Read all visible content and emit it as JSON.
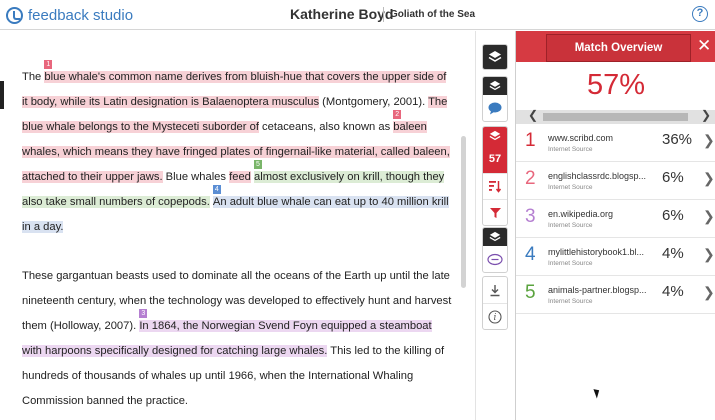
{
  "app": {
    "logo_text": "feedback studio",
    "student_name": "Katherine Boyd",
    "doc_title": "Goliath of the Sea",
    "help_symbol": "?"
  },
  "toolbar": {
    "match_count": "57"
  },
  "panel": {
    "title": "Match Overview",
    "close_symbol": "✕",
    "score": "57%",
    "nav_left": "❮",
    "nav_right": "❯",
    "matches": [
      {
        "num": "1",
        "source": "www.scribd.com",
        "type": "Internet Source",
        "pct": "36%",
        "color": "#d42a36"
      },
      {
        "num": "2",
        "source": "englishclassrdc.blogsp...",
        "type": "Internet Source",
        "pct": "6%",
        "color": "#e8677d"
      },
      {
        "num": "3",
        "source": "en.wikipedia.org",
        "type": "Internet Source",
        "pct": "6%",
        "color": "#b57fd1"
      },
      {
        "num": "4",
        "source": "mylittlehistorybook1.bl...",
        "type": "Internet Source",
        "pct": "4%",
        "color": "#3a7bbf"
      },
      {
        "num": "5",
        "source": "animals-partner.blogsp...",
        "type": "Internet Source",
        "pct": "4%",
        "color": "#5aa33e"
      }
    ]
  },
  "document": {
    "p1": {
      "s1": "The ",
      "m1": "blue whale's common name derives from bluish-hue that covers the upper side of it body, while its Latin designation is Balaenoptera musculus",
      "s2": " (Montgomery, 2001). ",
      "m1b": "The blue whale belongs to the Mysteceti suborder of",
      "s3": " cetaceans, also known as ",
      "m2": "baleen whales, which means they have fringed plates of fingernail-like material, called baleen, attached to their upper jaws.",
      "s4": " Blue whales ",
      "m1c": "feed",
      "s5": " ",
      "m5": "almost exclusively on krill, though they also take small numbers of copepods.",
      "s6": " ",
      "m4": "An adult blue whale can eat up to 40 million krill in a day.",
      "b1": "1",
      "b2": "2",
      "b5": "5",
      "b4": "4"
    },
    "p2": {
      "s1": "These gargantuan beasts used to dominate all the oceans of the Earth up until the late nineteenth century, when the technology was developed to effectively hunt and harvest them (Holloway, 2007). ",
      "m3": "In 1864, the Norwegian Svend Foyn equipped a steamboat with harpoons specifically designed for catching large whales.",
      "s2": " This led to the killing of hundreds of thousands of whales up until 1966, when the International Whaling Commission banned the practice.",
      "b3": "3"
    }
  }
}
